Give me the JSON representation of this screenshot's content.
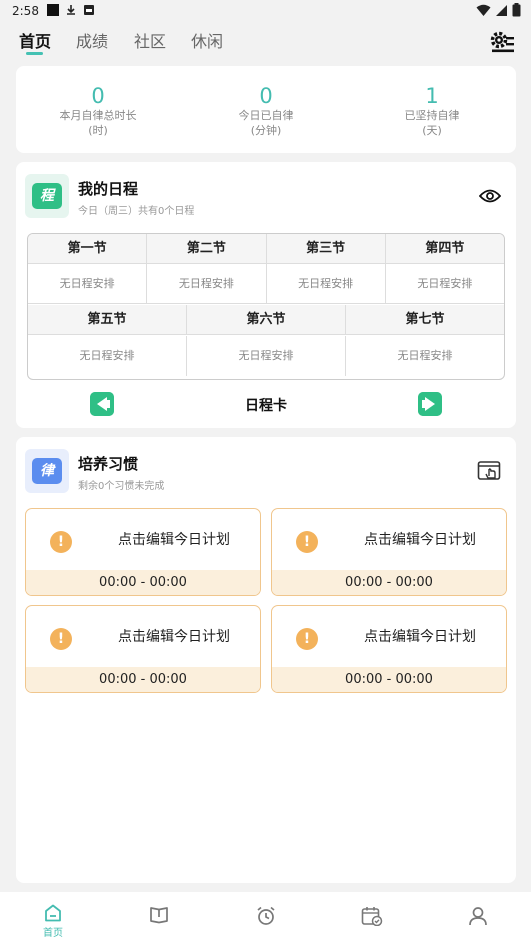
{
  "status_bar": {
    "time": "2:58"
  },
  "tabs": [
    "首页",
    "成绩",
    "社区",
    "休闲"
  ],
  "stats": [
    {
      "value": "0",
      "label1": "本月自律总时长",
      "label2": "(时)"
    },
    {
      "value": "0",
      "label1": "今日已自律",
      "label2": "(分钟)"
    },
    {
      "value": "1",
      "label1": "已坚持自律",
      "label2": "(天)"
    }
  ],
  "schedule": {
    "icon_char": "程",
    "title": "我的日程",
    "subtitle": "今日（周三）共有0个日程",
    "row1_headers": [
      "第一节",
      "第二节",
      "第三节",
      "第四节"
    ],
    "row2_headers": [
      "第五节",
      "第六节",
      "第七节"
    ],
    "empty_text": "无日程安排",
    "card_label": "日程卡"
  },
  "habit": {
    "icon_char": "律",
    "title": "培养习惯",
    "subtitle": "剩余0个习惯未完成",
    "plans": [
      {
        "text": "点击编辑今日计划",
        "time": "00:00 - 00:00"
      },
      {
        "text": "点击编辑今日计划",
        "time": "00:00 - 00:00"
      },
      {
        "text": "点击编辑今日计划",
        "time": "00:00 - 00:00"
      },
      {
        "text": "点击编辑今日计划",
        "time": "00:00 - 00:00"
      }
    ]
  },
  "bottom_nav": {
    "home_label": "首页"
  },
  "colors": {
    "accent": "#44bcb0",
    "green": "#2fbf86",
    "orange": "#f3b25b",
    "blue": "#5b8def"
  }
}
